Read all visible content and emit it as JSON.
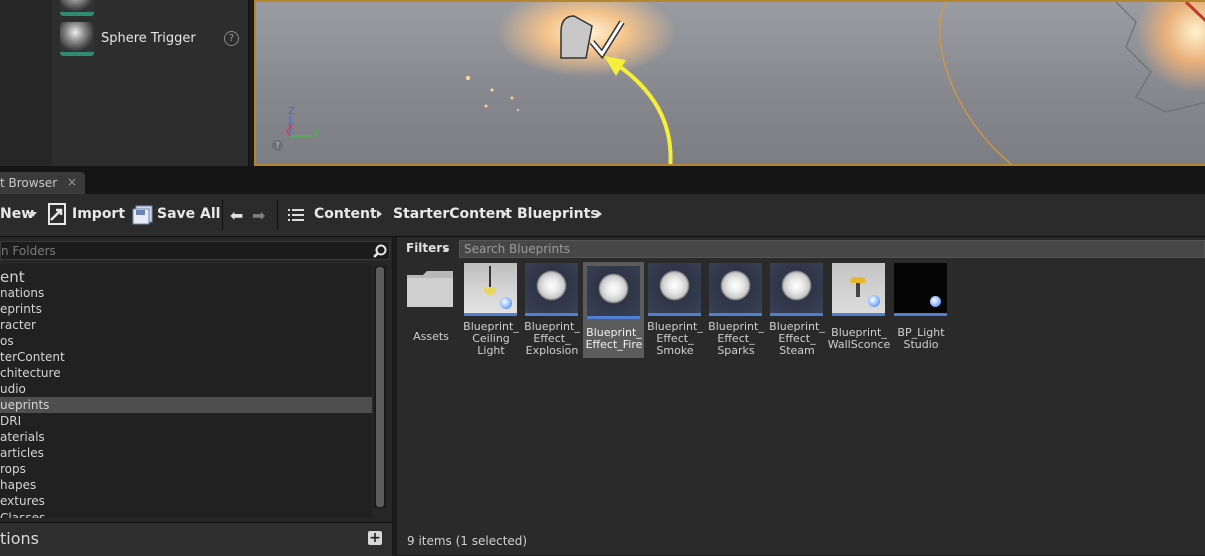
{
  "modes": {
    "item_label": "Sphere Trigger",
    "help_glyph": "?"
  },
  "viewport": {
    "axis_labels": {
      "z": "Z",
      "x": "X",
      "y": "Y"
    },
    "help_glyph": "?"
  },
  "tab": {
    "label": "t Browser",
    "close_glyph": "×"
  },
  "toolbar": {
    "new_label": "New",
    "import_label": "Import",
    "save_all_label": "Save All",
    "breadcrumb": [
      "Content",
      "StarterContent",
      "Blueprints"
    ]
  },
  "folders": {
    "search_placeholder": "n Folders",
    "tree": [
      "ent",
      "nations",
      "eprints",
      "racter",
      "os",
      "terContent",
      "chitecture",
      "udio",
      "ueprints",
      "DRI",
      "aterials",
      "articles",
      "rops",
      "hapes",
      "extures",
      "Classes"
    ],
    "selected_index": 8
  },
  "collections": {
    "label": "tions",
    "add_glyph": "+"
  },
  "assets": {
    "filters_label": "Filters",
    "search_placeholder": "Search Blueprints",
    "items": [
      {
        "name": "Assets",
        "kind": "folder"
      },
      {
        "name": "Blueprint_\nCeiling\nLight",
        "kind": "ceiling"
      },
      {
        "name": "Blueprint_\nEffect_\nExplosion",
        "kind": "sphere"
      },
      {
        "name": "Blueprint_\nEffect_Fire",
        "kind": "sphere"
      },
      {
        "name": "Blueprint_\nEffect_\nSmoke",
        "kind": "sphere"
      },
      {
        "name": "Blueprint_\nEffect_\nSparks",
        "kind": "sphere"
      },
      {
        "name": "Blueprint_\nEffect_\nSteam",
        "kind": "sphere"
      },
      {
        "name": "Blueprint_\nWallSconce",
        "kind": "sconce"
      },
      {
        "name": "BP_Light\nStudio",
        "kind": "studio"
      }
    ],
    "selected_index": 3,
    "status": "9 items (1 selected)"
  },
  "colors": {
    "accent_blue": "#4f7fd2",
    "highlight_yellow": "#f5ef3a",
    "viewport_border": "#b3862f"
  }
}
